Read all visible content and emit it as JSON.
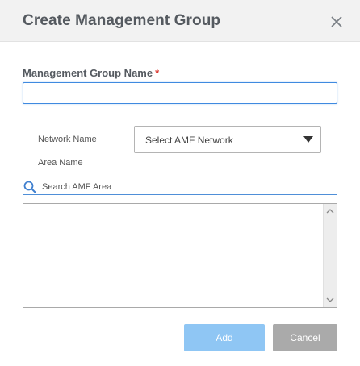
{
  "dialog": {
    "title": "Create Management Group",
    "close_icon": "close-icon"
  },
  "form": {
    "group_name_label": "Management Group Name",
    "required_marker": "*",
    "group_name_value": "",
    "network_label": "Network Name",
    "network_select": {
      "selected": "Select AMF Network",
      "icon": "caret-down-icon"
    },
    "area_label": "Area Name",
    "area_search": {
      "placeholder": "Search AMF Area",
      "value": "",
      "icon": "search-icon"
    },
    "area_list": {
      "items": []
    }
  },
  "buttons": {
    "add_label": "Add",
    "cancel_label": "Cancel"
  },
  "colors": {
    "header_bg": "#f2f2f2",
    "title_text": "#555a60",
    "required": "#d9342b",
    "accent": "#3f8ae0",
    "add_button_disabled": "#8fc6f4",
    "cancel_button": "#aaaaaa"
  }
}
